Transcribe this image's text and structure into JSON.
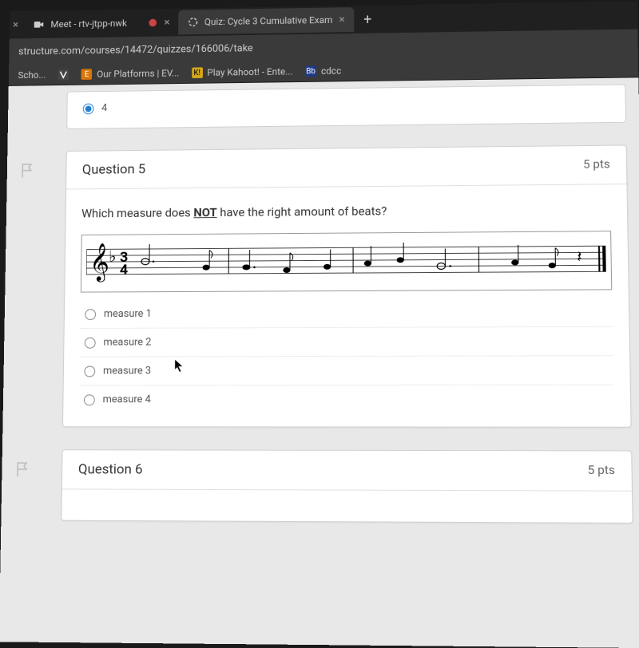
{
  "tabs": [
    {
      "label": "Meet - rtv-jtpp-nwk",
      "close": "×"
    },
    {
      "label": "",
      "close": "×"
    },
    {
      "label": "Quiz: Cycle 3 Cumulative Exam",
      "close": "×"
    }
  ],
  "new_tab": "+",
  "url": "structure.com/courses/14472/quizzes/166006/take",
  "bookmarks": [
    {
      "label": "Scho..."
    },
    {
      "label": ""
    },
    {
      "label": "Our Platforms | EV..."
    },
    {
      "label": "Play Kahoot! - Ente..."
    },
    {
      "label": "cdcc"
    }
  ],
  "prev_answer": {
    "value": "4"
  },
  "question5": {
    "title": "Question 5",
    "pts": "5 pts",
    "text_before": "Which measure does ",
    "text_bold": "NOT",
    "text_after": " have the right amount of beats?",
    "answers": [
      {
        "label": "measure 1"
      },
      {
        "label": "measure 2"
      },
      {
        "label": "measure 3"
      },
      {
        "label": "measure 4"
      }
    ]
  },
  "question6": {
    "title": "Question 6",
    "pts": "5 pts"
  }
}
